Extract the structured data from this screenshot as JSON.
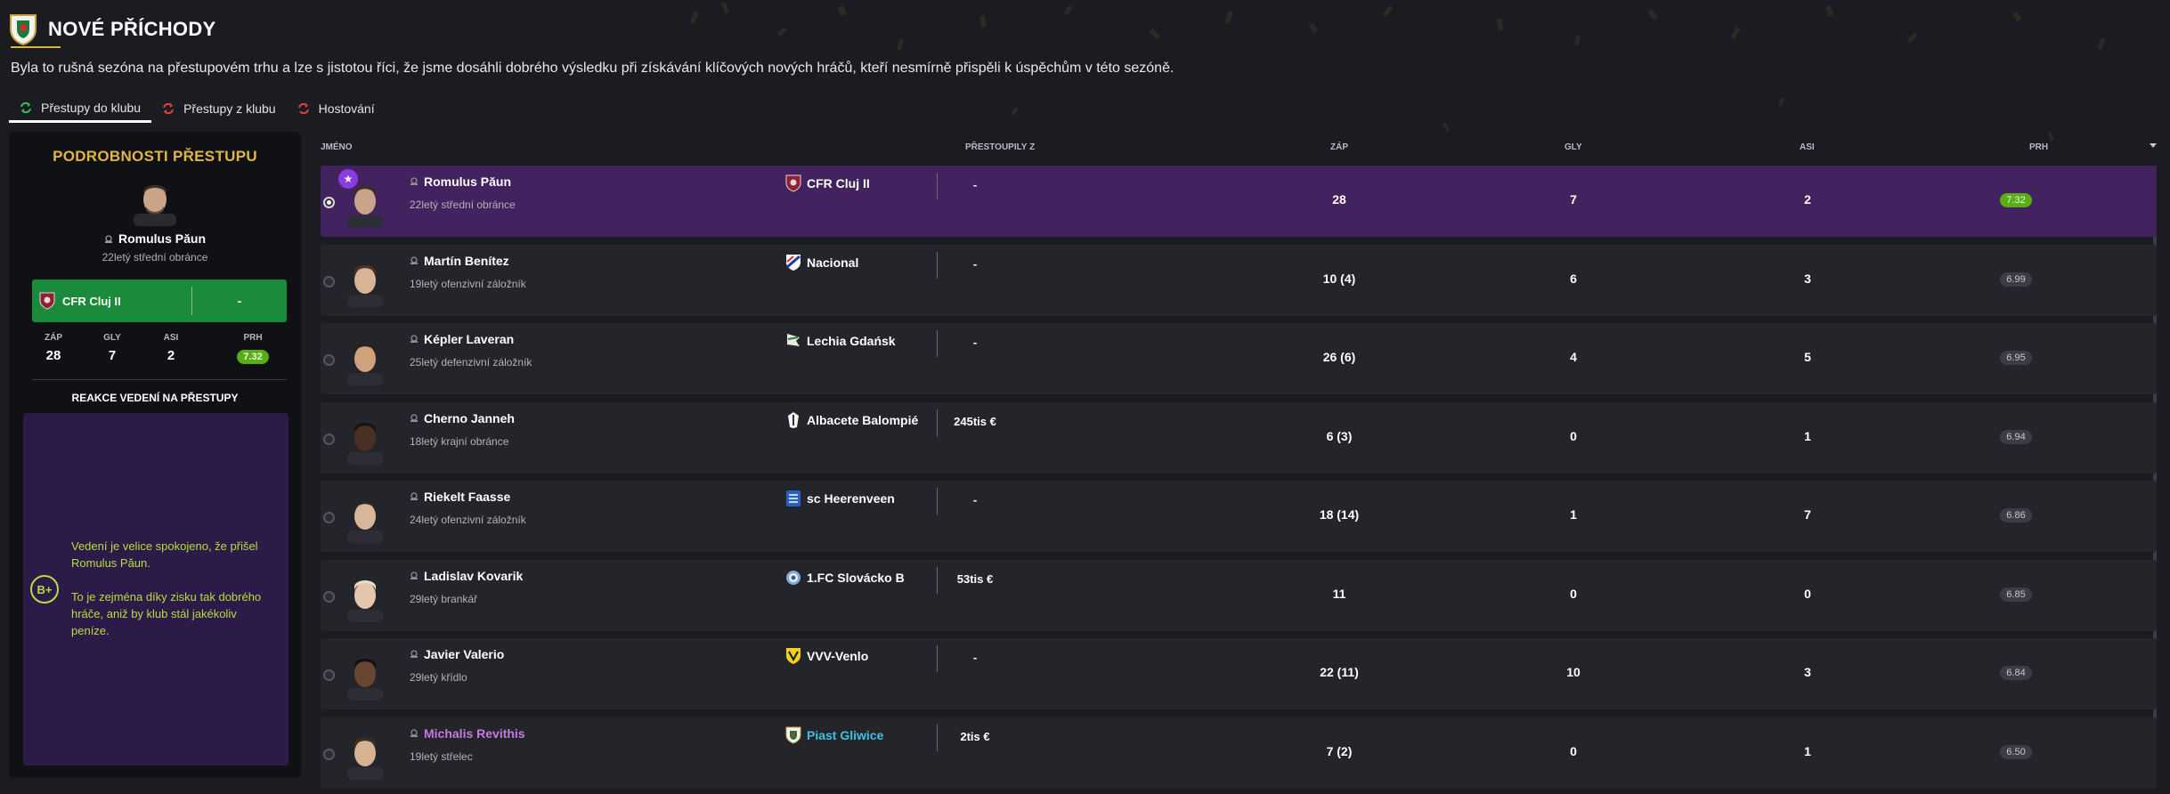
{
  "page": {
    "title": "NOVÉ PŘÍCHODY",
    "intro": "Byla to rušná sezóna na přestupovém trhu a lze s jistotou říci, že jsme dosáhli dobrého výsledku při získávání klíčových nových hráčů, kteří nesmírně přispěli k úspěchům v této sezóně."
  },
  "tabs": [
    {
      "label": "Přestupy do klubu",
      "active": true
    },
    {
      "label": "Přestupy z klubu",
      "active": false
    },
    {
      "label": "Hostování",
      "active": false
    }
  ],
  "details": {
    "title": "PODROBNOSTI PŘESTUPU",
    "player_name": "Romulus Păun",
    "player_desc": "22letý střední obránce",
    "club": "CFR Cluj II",
    "fee": "-",
    "stats": [
      {
        "label": "ZÁP",
        "value": "28"
      },
      {
        "label": "GLY",
        "value": "7"
      },
      {
        "label": "ASI",
        "value": "2"
      },
      {
        "label": "PRH",
        "value": "7.32"
      }
    ],
    "reaction_title": "REAKCE VEDENÍ NA PŘESTUPY",
    "grade": "B+",
    "reaction_p1": "Vedení je velice spokojeno, že přišel Romulus Păun.",
    "reaction_p2": "To je zejména díky zisku tak dobrého hráče, aniž by klub stál jakékoliv peníze."
  },
  "table": {
    "headers": {
      "name": "JMÉNO",
      "from": "PŘESTOUPILY Z",
      "apps": "ZÁP",
      "goals": "GLY",
      "assists": "ASI",
      "rating": "PRH"
    },
    "rows": [
      {
        "name": "Romulus Păun",
        "desc": "22letý střední obránce",
        "club": "CFR Cluj II",
        "fee": "-",
        "apps": "28",
        "goals": "7",
        "assists": "2",
        "rating": "7.32"
      },
      {
        "name": "Martín Benítez",
        "desc": "19letý ofenzivní záložník",
        "club": "Nacional",
        "fee": "-",
        "apps": "10 (4)",
        "goals": "6",
        "assists": "3",
        "rating": "6.99"
      },
      {
        "name": "Képler Laveran",
        "desc": "25letý defenzivní záložník",
        "club": "Lechia Gdańsk",
        "fee": "-",
        "apps": "26 (6)",
        "goals": "4",
        "assists": "5",
        "rating": "6.95"
      },
      {
        "name": "Cherno Janneh",
        "desc": "18letý krajní obránce",
        "club": "Albacete Balompié",
        "fee": "245tis €",
        "apps": "6 (3)",
        "goals": "0",
        "assists": "1",
        "rating": "6.94"
      },
      {
        "name": "Riekelt Faasse",
        "desc": "24letý ofenzivní záložník",
        "club": "sc Heerenveen",
        "fee": "-",
        "apps": "18 (14)",
        "goals": "1",
        "assists": "7",
        "rating": "6.86"
      },
      {
        "name": "Ladislav Kovarik",
        "desc": "29letý brankář",
        "club": "1.FC Slovácko B",
        "fee": "53tis €",
        "apps": "11",
        "goals": "0",
        "assists": "0",
        "rating": "6.85"
      },
      {
        "name": "Javier Valerio",
        "desc": "29letý křídlo",
        "club": "VVV-Venlo",
        "fee": "-",
        "apps": "22 (11)",
        "goals": "10",
        "assists": "3",
        "rating": "6.84"
      },
      {
        "name": "Michalis Revithis",
        "desc": "19letý střelec",
        "club": "Piast Gliwice",
        "fee": "2tis €",
        "apps": "7 (2)",
        "goals": "0",
        "assists": "1",
        "rating": "6.50"
      }
    ]
  },
  "colors": {
    "accent_gold": "#e0b640",
    "selected_row": "#42225f",
    "club_green": "#1b8a3a",
    "rating_green": "#5aac1a",
    "reaction_box": "#2c1b48",
    "reaction_text": "#b7dd3e"
  }
}
